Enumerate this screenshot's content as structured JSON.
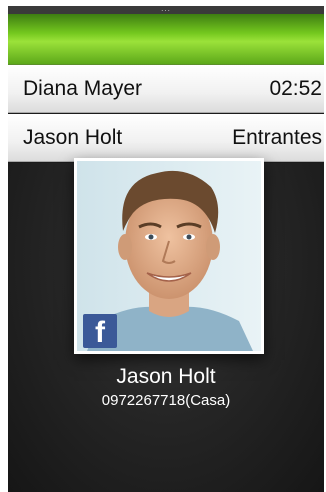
{
  "header": {
    "grip": "..."
  },
  "calls": [
    {
      "name": "Diana Mayer",
      "info": "02:52"
    },
    {
      "name": "Jason Holt",
      "info": "Entrantes"
    }
  ],
  "caller": {
    "name": "Jason Holt",
    "number": "0972267718(Casa)",
    "badge": "f",
    "badge_icon": "facebook-icon"
  },
  "colors": {
    "accent_green": "#74c81e",
    "background_dark": "#1b1b1b",
    "facebook_blue": "#3b5998"
  }
}
